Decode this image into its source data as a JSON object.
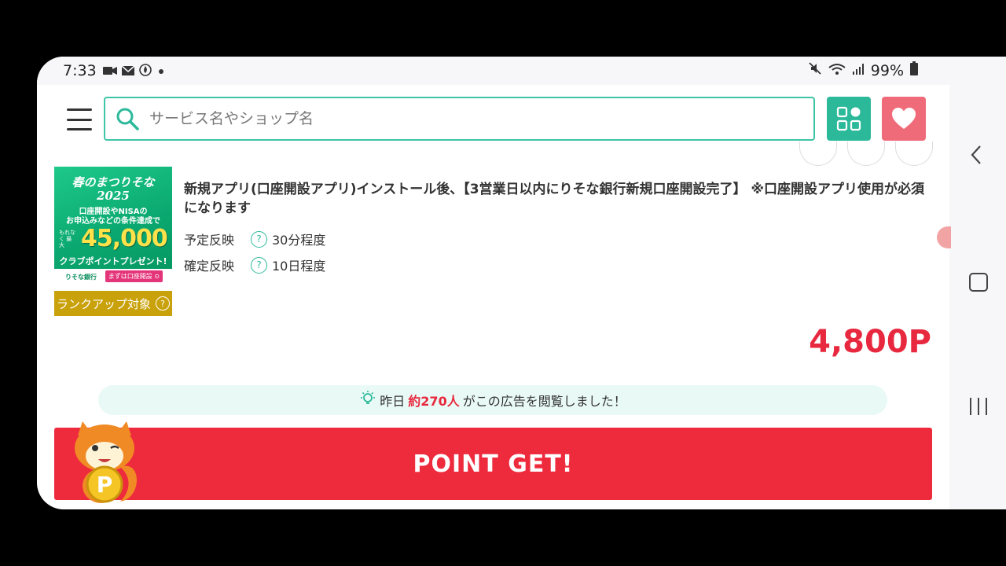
{
  "statusbar": {
    "time": "7:33",
    "left_icons": [
      "video-camera-icon",
      "mail-icon",
      "fire-icon",
      "dot-icon"
    ],
    "battery": "99%",
    "right_icons": [
      "mute-icon",
      "wifi-icon",
      "signal-icon",
      "battery-icon"
    ]
  },
  "header": {
    "search_placeholder": "サービス名やショップ名",
    "icons": [
      "menu-icon",
      "search-icon",
      "category-icon",
      "heart-icon"
    ]
  },
  "offer": {
    "banner": {
      "title_line1": "春のまつりそな",
      "title_line2": "2025",
      "sub_line1": "口座開設やNISAの",
      "sub_line2": "お申込みなどの条件達成で",
      "small_text": "もれなく 最大",
      "amount": "45,000",
      "footer": "クラブポイントプレゼント!",
      "bank": "りそな銀行",
      "pill": "まずは口座開設 ⊙"
    },
    "rank_badge": "ランクアップ対象",
    "title": "新規アプリ(口座開設アプリ)インストール後、【3営業日以内にりそな銀行新規口座開設完了】 ※口座開設アプリ使用が必須になります",
    "rows": [
      {
        "label": "予定反映",
        "value": "30分程度"
      },
      {
        "label": "確定反映",
        "value": "10日程度"
      }
    ],
    "points": "4,800P"
  },
  "views": {
    "prefix": "昨日",
    "count": "約270人",
    "suffix": "がこの広告を閲覧しました！"
  },
  "cta": {
    "label": "POINT GET!"
  },
  "colors": {
    "accent": "#2bb99a",
    "favorite": "#f06b7a",
    "points": "#e8283e",
    "cta": "#ee2a3d",
    "badge": "#c9a10a"
  }
}
